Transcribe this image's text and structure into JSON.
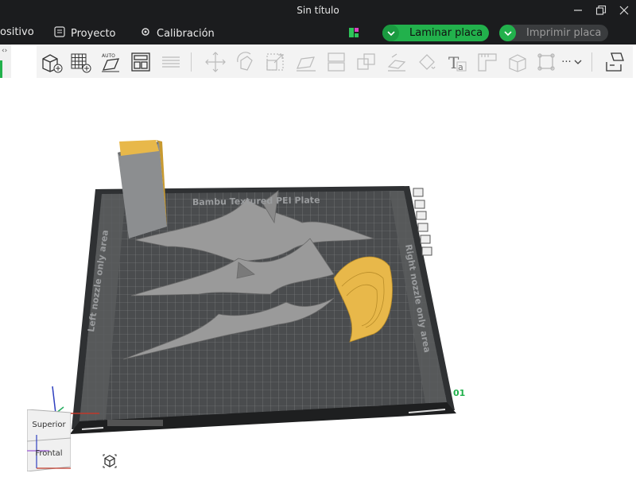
{
  "window": {
    "title": "Sin título",
    "controls": [
      "minimize-icon",
      "restore-icon",
      "close-icon"
    ]
  },
  "menu": {
    "dispositivo_label": "ositivo",
    "proyecto_label": "Proyecto",
    "calibracion_label": "Calibración"
  },
  "actions": {
    "slice_label": "Laminar placa",
    "print_label": "Imprimir placa",
    "accent": "#22b14c"
  },
  "toolbar": {
    "tools": [
      "add-object-icon",
      "add-plate-icon",
      "auto-orient-icon",
      "arrange-icon",
      "layers-icon",
      "move-icon",
      "rotate-icon",
      "scale-icon",
      "lay-on-face-icon",
      "cut-icon",
      "split-icon",
      "support-paint-icon",
      "seam-paint-icon",
      "text-icon",
      "measure-icon",
      "assembly-icon",
      "fit-view-icon"
    ],
    "more_label": "···"
  },
  "viewport": {
    "plate_title": "Bambu Textured PEI Plate",
    "left_zone_label": "Left nozzle only area",
    "right_zone_label": "Right nozzle only area",
    "plate_number": "01",
    "plate_color": "#4a4c4e",
    "model_color": "#9a9a9a",
    "highlight_color": "#e8b84a"
  },
  "view_cube": {
    "top_label": "Superior",
    "front_label": "Frontal"
  }
}
